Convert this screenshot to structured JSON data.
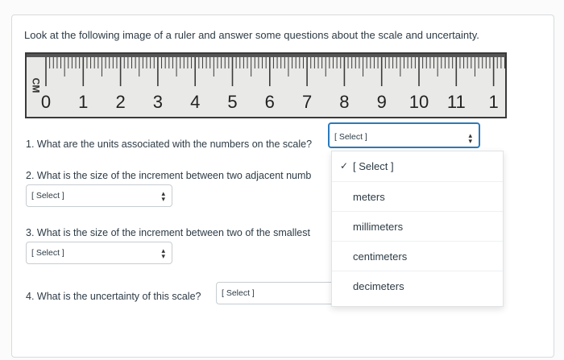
{
  "prompt": "Look at the following image of a ruler and answer some questions about the scale and uncertainty.",
  "ruler": {
    "unit": "CM",
    "numbers": [
      "0",
      "1",
      "2",
      "3",
      "4",
      "5",
      "6",
      "7",
      "8",
      "9",
      "10",
      "11",
      "1"
    ]
  },
  "questions": {
    "q1": {
      "text": "1. What are the units associated with the numbers on the scale?",
      "select": "[ Select ]"
    },
    "q2": {
      "text": "2. What is the size of the increment between two adjacent numb",
      "select": "[ Select ]"
    },
    "q3": {
      "text": "3. What is the size of the increment between two of the smallest",
      "select": "[ Select ]"
    },
    "q4": {
      "text": "4. What is the uncertainty of this scale?",
      "select": "[ Select ]"
    }
  },
  "dropdown": {
    "options": [
      "[ Select ]",
      "meters",
      "millimeters",
      "centimeters",
      "decimeters"
    ],
    "selected_check": "✓"
  },
  "icons": {
    "select_arrow": "updown-chevron-icon",
    "check": "checkmark-icon"
  }
}
